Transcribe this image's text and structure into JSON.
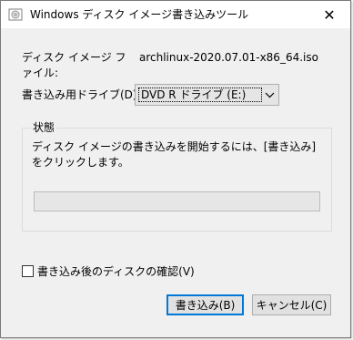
{
  "window": {
    "title": "Windows ディスク イメージ書き込みツール",
    "close_symbol": "✕"
  },
  "file": {
    "label": "ディスク イメージ ファイル:",
    "value": "archlinux-2020.07.01-x86_64.iso"
  },
  "drive": {
    "label": "書き込み用ドライブ(D):",
    "selected": "DVD R ドライブ (E:)"
  },
  "status_group": {
    "legend": "状態",
    "message": "ディスク イメージの書き込みを開始するには、[書き込み] をクリックします。"
  },
  "progress": {
    "fraction": 0.0
  },
  "verify": {
    "label": "書き込み後のディスクの確認(V)",
    "checked": false
  },
  "buttons": {
    "write_label": "書き込み(B)",
    "cancel_label": "キャンセル(C)"
  },
  "icons": {
    "app": "disc-image-icon",
    "close": "close-icon",
    "dropdown": "chevron-down-icon"
  }
}
